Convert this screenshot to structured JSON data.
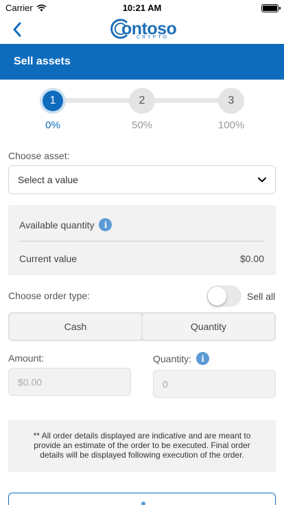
{
  "status_bar": {
    "carrier": "Carrier",
    "time": "10:21 AM"
  },
  "nav": {
    "logo_brand": "ontoso",
    "logo_sub": "CRYPTO"
  },
  "header": {
    "title": "Sell assets"
  },
  "stepper": {
    "steps": [
      {
        "number": "1",
        "percent": "0%",
        "active": true
      },
      {
        "number": "2",
        "percent": "50%",
        "active": false
      },
      {
        "number": "3",
        "percent": "100%",
        "active": false
      }
    ]
  },
  "asset": {
    "label": "Choose asset:",
    "selected": "Select a value"
  },
  "info": {
    "available_label": "Available quantity",
    "current_label": "Current value",
    "current_value": "$0.00"
  },
  "order": {
    "label": "Choose order type:",
    "sell_all_label": "Sell all",
    "sell_all_on": false,
    "options": [
      "Cash",
      "Quantity"
    ]
  },
  "amount": {
    "label": "Amount:",
    "placeholder": "$0.00"
  },
  "quantity": {
    "label": "Quantity:",
    "placeholder": "0"
  },
  "disclaimer": "** All order details displayed are indicative and are meant to provide an estimate of the order to be executed. Final order details will be displayed following execution of the order.",
  "colors": {
    "accent": "#0f6cbd",
    "info_icon": "#5b9bd5",
    "card_bg": "#f2f2f2"
  }
}
